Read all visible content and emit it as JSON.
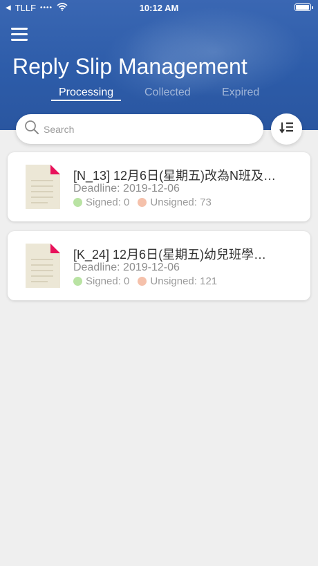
{
  "status_bar": {
    "carrier": "TLLF",
    "time": "10:12 AM"
  },
  "header": {
    "title": "Reply Slip Management",
    "tabs": [
      {
        "label": "Processing",
        "active": true
      },
      {
        "label": "Collected",
        "active": false
      },
      {
        "label": "Expired",
        "active": false
      }
    ]
  },
  "search": {
    "placeholder": "Search"
  },
  "slips": [
    {
      "title": "[N_13] 12月6日(星期五)改為N班及…",
      "deadline": "Deadline: 2019-12-06",
      "signed": "Signed: 0",
      "unsigned": "Unsigned: 73"
    },
    {
      "title": "[K_24] 12月6日(星期五)幼兒班學…",
      "deadline": "Deadline: 2019-12-06",
      "signed": "Signed: 0",
      "unsigned": "Unsigned: 121"
    }
  ],
  "colors": {
    "header_blue": "#2d5ca9",
    "signed_dot": "#b9e3a3",
    "unsigned_dot": "#f5c1ab",
    "doc_corner": "#e8115a"
  },
  "icons": [
    "back-arrow-icon",
    "wifi-icon",
    "battery-icon",
    "menu-icon",
    "search-icon",
    "sort-icon",
    "document-icon"
  ]
}
